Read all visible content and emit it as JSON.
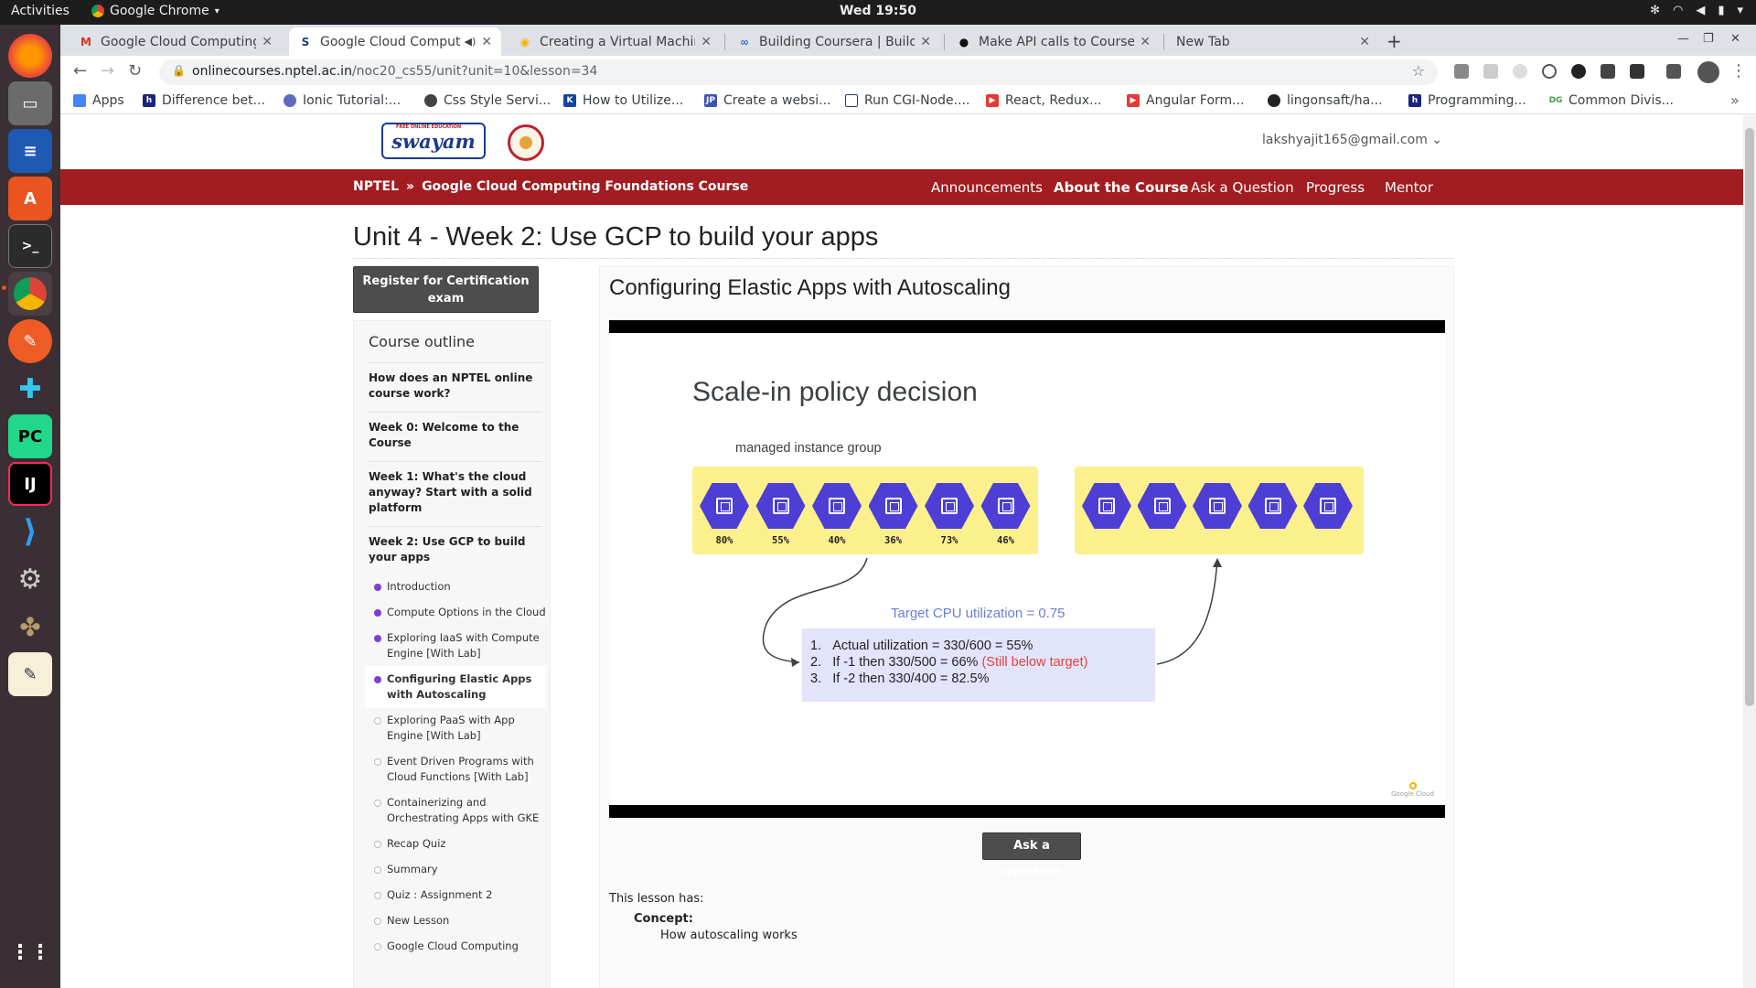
{
  "os": {
    "activities": "Activities",
    "app_name": "Google Chrome",
    "clock": "Wed 19:50"
  },
  "browser": {
    "tabs": [
      {
        "title": "Google Cloud Computing",
        "favicon": "gmail-icon",
        "active": false
      },
      {
        "title": "Google Cloud Comput",
        "favicon": "swayam-icon",
        "active": true
      },
      {
        "title": "Creating a Virtual Machin",
        "favicon": "qwiklabs-icon",
        "active": false
      },
      {
        "title": "Building Coursera | Buildi",
        "favicon": "coursera-icon",
        "active": false
      },
      {
        "title": "Make API calls to Courser",
        "favicon": "github-icon",
        "active": false
      },
      {
        "title": "New Tab",
        "favicon": "",
        "active": false
      }
    ],
    "url_host": "onlinecourses.nptel.ac.in",
    "url_path": "/noc20_cs55/unit?unit=10&lesson=34",
    "bookmarks": [
      {
        "label": "Apps",
        "color": "#4285f4"
      },
      {
        "label": "Difference bet...",
        "color": "#1a237e"
      },
      {
        "label": "Ionic Tutorial:...",
        "color": "#5c6bc0"
      },
      {
        "label": "Css Style Servi...",
        "color": "#444444"
      },
      {
        "label": "How to Utilize...",
        "color": "#0d47a1"
      },
      {
        "label": "Create a websi...",
        "color": "#3f51b5"
      },
      {
        "label": "Run CGI-Node....",
        "color": "#283593"
      },
      {
        "label": "React, Redux...",
        "color": "#e53935"
      },
      {
        "label": "Angular Form...",
        "color": "#e53935"
      },
      {
        "label": "lingonsaft/ha...",
        "color": "#222222"
      },
      {
        "label": "Programming...",
        "color": "#1a237e"
      },
      {
        "label": "Common Divis...",
        "color": "#43a047"
      }
    ]
  },
  "site": {
    "logo_text": "swayam",
    "logo_top": "FREE ONLINE EDUCATION",
    "user_email": "lakshyajit165@gmail.com ⌄",
    "crumb_root": "NPTEL",
    "crumb_sep": "»",
    "crumb_course": "Google Cloud Computing Foundations Course",
    "nav": [
      "Announcements",
      "About the Course",
      "Ask a Question",
      "Progress",
      "Mentor"
    ],
    "unit_title": "Unit 4 - Week 2: Use GCP to build your apps",
    "register_label": "Register for Certification exam"
  },
  "outline": {
    "title": "Course outline",
    "sections": [
      "How does an NPTEL online course work?",
      "Week 0: Welcome to the Course",
      "Week 1: What's the cloud anyway? Start with a solid platform",
      "Week 2: Use GCP to build your apps"
    ],
    "lessons": [
      {
        "label": "Introduction",
        "done": true,
        "current": false
      },
      {
        "label": "Compute Options in the Cloud",
        "done": true,
        "current": false
      },
      {
        "label": "Exploring IaaS with Compute Engine [With Lab]",
        "done": true,
        "current": false
      },
      {
        "label": "Configuring Elastic Apps with Autoscaling",
        "done": true,
        "current": true
      },
      {
        "label": "Exploring PaaS with App Engine [With Lab]",
        "done": false,
        "current": false
      },
      {
        "label": "Event Driven Programs with Cloud Functions [With Lab]",
        "done": false,
        "current": false
      },
      {
        "label": "Containerizing and Orchestrating Apps with GKE",
        "done": false,
        "current": false
      },
      {
        "label": "Recap Quiz",
        "done": false,
        "current": false
      },
      {
        "label": "Summary",
        "done": false,
        "current": false
      },
      {
        "label": "Quiz : Assignment 2",
        "done": false,
        "current": false
      },
      {
        "label": "New Lesson",
        "done": false,
        "current": false
      },
      {
        "label": "Google Cloud Computing",
        "done": false,
        "current": false
      }
    ]
  },
  "lesson": {
    "title": "Configuring Elastic Apps with Autoscaling",
    "slide": {
      "title": "Scale-in policy decision",
      "group_label": "managed instance group",
      "utilizations": [
        "80%",
        "55%",
        "40%",
        "36%",
        "73%",
        "46%"
      ],
      "right_group_count": 5,
      "target_label": "Target CPU utilization = 0.75",
      "calc": [
        {
          "num": "1.",
          "text": "Actual utilization = 330/600 = 55%",
          "note": ""
        },
        {
          "num": "2.",
          "text": "If -1 then 330/500 = 66% ",
          "note": "(Still below target)"
        },
        {
          "num": "3.",
          "text": "If -2 then 330/400 = 82.5%",
          "note": ""
        }
      ],
      "brand": "Google Cloud",
      "colors": {
        "hex": "#4d3ed6",
        "group": "#fcf08c",
        "calc_bg": "#e2e4fb",
        "warn": "#e0443a",
        "target": "#6a7fd3"
      }
    },
    "ask_label": "Ask a question",
    "has_label": "This lesson has:",
    "concept_label": "Concept:",
    "concept_value": "How autoscaling works"
  }
}
